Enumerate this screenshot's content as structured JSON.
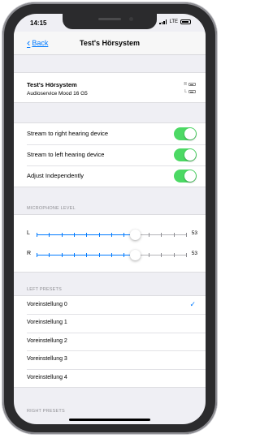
{
  "status_bar": {
    "time": "14:15",
    "carrier": "LTE"
  },
  "nav": {
    "back_label": "Back",
    "title": "Test's Hörsystem"
  },
  "device": {
    "name": "Test's Hörsystem",
    "model": "Audioservice Mood 16 G5",
    "right_label": "R",
    "left_label": "L"
  },
  "toggles": [
    {
      "label": "Stream to right hearing device",
      "on": true
    },
    {
      "label": "Stream to left hearing device",
      "on": true
    },
    {
      "label": "Adjust Independently",
      "on": true
    }
  ],
  "microphone": {
    "header": "MICROPHONE LEVEL",
    "max": 80,
    "ticks": 13,
    "sliders": [
      {
        "label": "L",
        "value": 53
      },
      {
        "label": "R",
        "value": 53
      }
    ]
  },
  "left_presets": {
    "header": "LEFT PRESETS",
    "items": [
      {
        "label": "Voreinstellung 0",
        "selected": true
      },
      {
        "label": "Voreinstellung 1",
        "selected": false
      },
      {
        "label": "Voreinstellung 2",
        "selected": false
      },
      {
        "label": "Voreinstellung 3",
        "selected": false
      },
      {
        "label": "Voreinstellung 4",
        "selected": false
      }
    ]
  },
  "right_presets": {
    "header": "RIGHT PRESETS"
  },
  "colors": {
    "accent": "#007aff",
    "toggle_on": "#4cd964",
    "background": "#efeff4"
  },
  "icons": {
    "back": "chevron-left-icon",
    "check": "checkmark-icon"
  }
}
